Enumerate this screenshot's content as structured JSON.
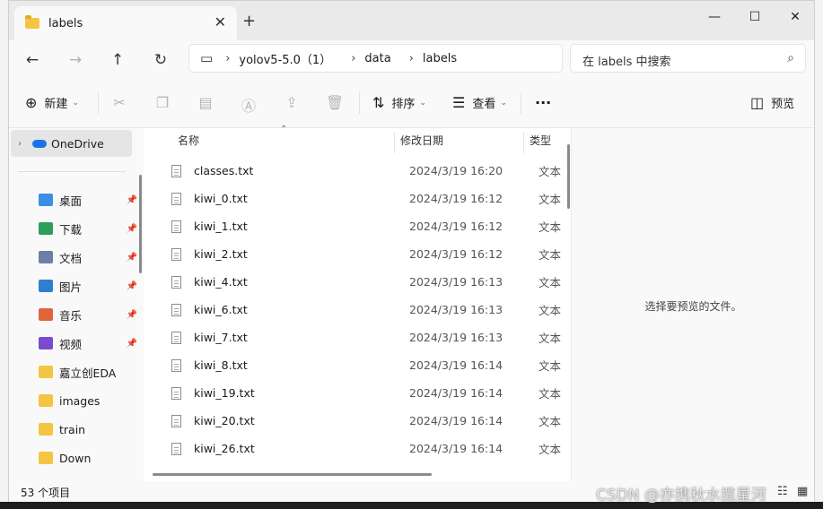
{
  "window": {
    "tab_title": "labels",
    "tab_close": "✕",
    "new_tab": "+",
    "minimize": "—",
    "maximize": "☐",
    "close": "✕"
  },
  "nav": {
    "back": "←",
    "forward": "→",
    "up": "↑",
    "refresh": "↻"
  },
  "address": {
    "computer_icon": "▭",
    "crumbs": [
      "yolov5-5.0（1）",
      "data",
      "labels"
    ],
    "separator": "›"
  },
  "search": {
    "placeholder": "在 labels 中搜索",
    "icon": "⌕"
  },
  "toolbar": {
    "new_label": "新建",
    "sort_label": "排序",
    "view_label": "查看",
    "more_label": "···",
    "preview_label": "预览"
  },
  "sidebar": {
    "onedrive": "OneDrive",
    "items": [
      {
        "label": "桌面",
        "pinned": true,
        "color": "#3a8ee6"
      },
      {
        "label": "下载",
        "pinned": true,
        "color": "#2e9e5b"
      },
      {
        "label": "文档",
        "pinned": true,
        "color": "#6d7fa6"
      },
      {
        "label": "图片",
        "pinned": true,
        "color": "#2f7fd1"
      },
      {
        "label": "音乐",
        "pinned": true,
        "color": "#e0653a"
      },
      {
        "label": "视频",
        "pinned": true,
        "color": "#7a4bd1"
      },
      {
        "label": "嘉立创EDA",
        "pinned": false,
        "color": "#f4c542"
      },
      {
        "label": "images",
        "pinned": false,
        "color": "#f4c542"
      },
      {
        "label": "train",
        "pinned": false,
        "color": "#f4c542"
      },
      {
        "label": "Down",
        "pinned": false,
        "color": "#f4c542"
      }
    ]
  },
  "columns": {
    "name": "名称",
    "modified": "修改日期",
    "type": "类型"
  },
  "files": [
    {
      "name": "classes.txt",
      "date": "2024/3/19 16:20",
      "type": "文本"
    },
    {
      "name": "kiwi_0.txt",
      "date": "2024/3/19 16:12",
      "type": "文本"
    },
    {
      "name": "kiwi_1.txt",
      "date": "2024/3/19 16:12",
      "type": "文本"
    },
    {
      "name": "kiwi_2.txt",
      "date": "2024/3/19 16:12",
      "type": "文本"
    },
    {
      "name": "kiwi_4.txt",
      "date": "2024/3/19 16:13",
      "type": "文本"
    },
    {
      "name": "kiwi_6.txt",
      "date": "2024/3/19 16:13",
      "type": "文本"
    },
    {
      "name": "kiwi_7.txt",
      "date": "2024/3/19 16:13",
      "type": "文本"
    },
    {
      "name": "kiwi_8.txt",
      "date": "2024/3/19 16:14",
      "type": "文本"
    },
    {
      "name": "kiwi_19.txt",
      "date": "2024/3/19 16:14",
      "type": "文本"
    },
    {
      "name": "kiwi_20.txt",
      "date": "2024/3/19 16:14",
      "type": "文本"
    },
    {
      "name": "kiwi_26.txt",
      "date": "2024/3/19 16:14",
      "type": "文本"
    }
  ],
  "preview": {
    "message": "选择要预览的文件。"
  },
  "status": {
    "count": "53 个项目"
  },
  "watermark": "CSDN @亦携秋水揽星河"
}
